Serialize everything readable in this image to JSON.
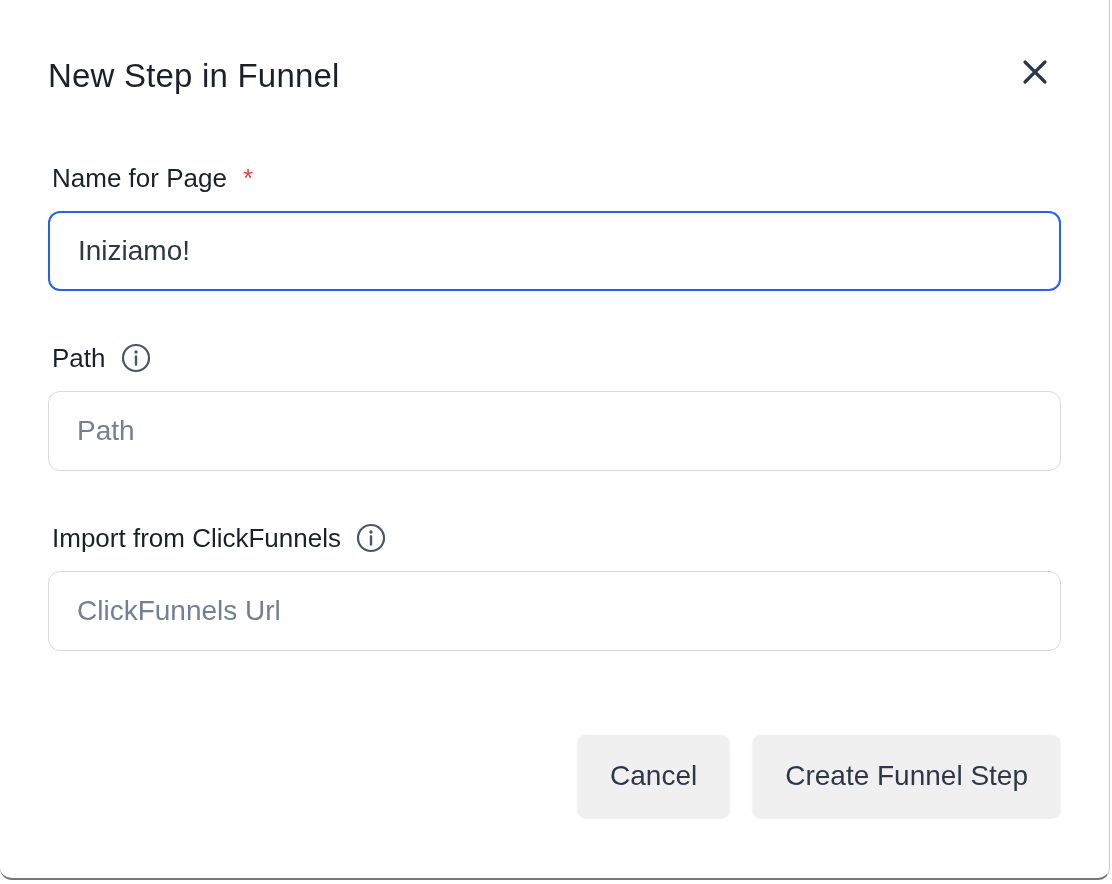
{
  "dialog": {
    "title": "New Step in Funnel"
  },
  "fields": [
    {
      "label": "Name for Page",
      "required_mark": "*",
      "info": false,
      "value": "Iniziamo!",
      "focused": true
    },
    {
      "label": "Path",
      "info": true,
      "placeholder": "Path",
      "focused": false
    },
    {
      "label": "Import from ClickFunnels",
      "info": true,
      "placeholder": "ClickFunnels Url",
      "focused": false
    }
  ],
  "buttons": [
    "Cancel",
    "Create Funnel Step"
  ]
}
